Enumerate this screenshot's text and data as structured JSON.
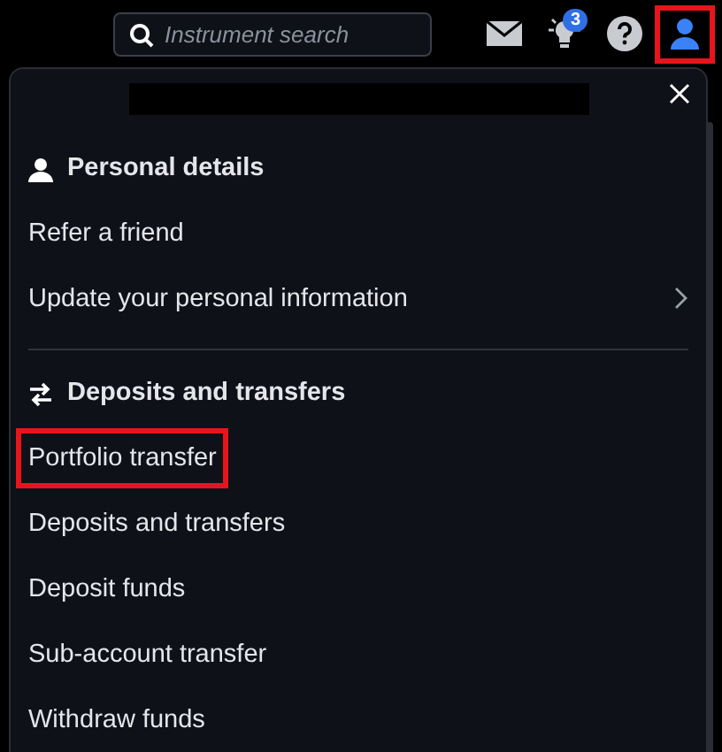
{
  "top_bar": {
    "search": {
      "placeholder": "Instrument search"
    },
    "ideas_badge": "3",
    "account_button_highlighted": true
  },
  "account_menu": {
    "name_redacted": true,
    "sections": [
      {
        "title": "Personal details",
        "kind": "person",
        "items": [
          {
            "label": "Refer a friend",
            "has_submenu": false,
            "highlighted": false
          },
          {
            "label": "Update your personal information",
            "has_submenu": true,
            "highlighted": false
          }
        ]
      },
      {
        "title": "Deposits and transfers",
        "kind": "transfer",
        "items": [
          {
            "label": "Portfolio transfer",
            "has_submenu": false,
            "highlighted": true
          },
          {
            "label": "Deposits and transfers",
            "has_submenu": false,
            "highlighted": false
          },
          {
            "label": "Deposit funds",
            "has_submenu": false,
            "highlighted": false
          },
          {
            "label": "Sub-account transfer",
            "has_submenu": false,
            "highlighted": false
          },
          {
            "label": "Withdraw funds",
            "has_submenu": false,
            "highlighted": false
          }
        ]
      }
    ]
  }
}
